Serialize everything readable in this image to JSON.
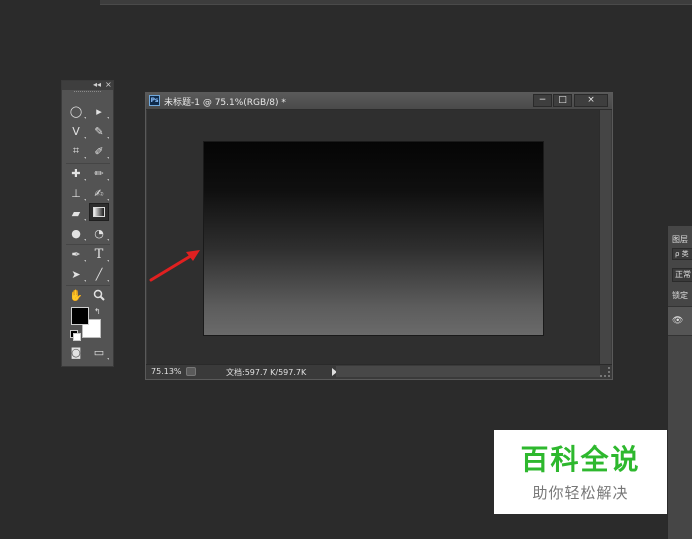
{
  "app": {
    "top_strip": ""
  },
  "tools_panel": {
    "collapse_glyph": "◂◂",
    "close_glyph": "×",
    "tools": [
      {
        "name": "elliptical-marquee-tool",
        "glyph": "◯"
      },
      {
        "name": "move-tool",
        "glyph": "▸"
      },
      {
        "name": "lasso-tool",
        "glyph": "ᐯ"
      },
      {
        "name": "quick-selection-tool",
        "glyph": "✎"
      },
      {
        "name": "crop-tool",
        "glyph": "⌗"
      },
      {
        "name": "eyedropper-tool",
        "glyph": "✐"
      },
      {
        "name": "spot-healing-brush-tool",
        "glyph": "✚"
      },
      {
        "name": "brush-tool",
        "glyph": "✏"
      },
      {
        "name": "clone-stamp-tool",
        "glyph": "⊥"
      },
      {
        "name": "history-brush-tool",
        "glyph": "✍"
      },
      {
        "name": "eraser-tool",
        "glyph": "▰"
      },
      {
        "name": "gradient-tool",
        "glyph": ""
      },
      {
        "name": "blur-tool",
        "glyph": "●"
      },
      {
        "name": "dodge-tool",
        "glyph": "◔"
      },
      {
        "name": "pen-tool",
        "glyph": "✒"
      },
      {
        "name": "type-tool",
        "glyph": "T"
      },
      {
        "name": "path-selection-tool",
        "glyph": "➤"
      },
      {
        "name": "line-tool",
        "glyph": "╱"
      },
      {
        "name": "hand-tool",
        "glyph": "✋"
      },
      {
        "name": "zoom-tool",
        "glyph": "🔍"
      }
    ],
    "foreground_color": "#000000",
    "background_color": "#ffffff",
    "quick_mask_glyph": "◙",
    "screen_mode_glyph": "▭"
  },
  "document": {
    "ps_badge": "Ps",
    "title": "未标题-1 @ 75.1%(RGB/8) *",
    "minimize_glyph": "−",
    "maximize_glyph": "□",
    "close_glyph": "×",
    "zoom_value": "75.13%",
    "doc_info": "文档:597.7 K/597.7K",
    "canvas_gradient_top": "#050505",
    "canvas_gradient_bottom": "#6a6a6a"
  },
  "layers_panel": {
    "tab_label": "图层",
    "search_glyph": "ρ 类",
    "blend_mode": "正常",
    "lock_label": "锁定",
    "eye_glyph": "👁"
  },
  "annotation": {
    "arrow_color": "#e02020"
  },
  "watermark": {
    "title": "百科全说",
    "subtitle": "助你轻松解决"
  }
}
